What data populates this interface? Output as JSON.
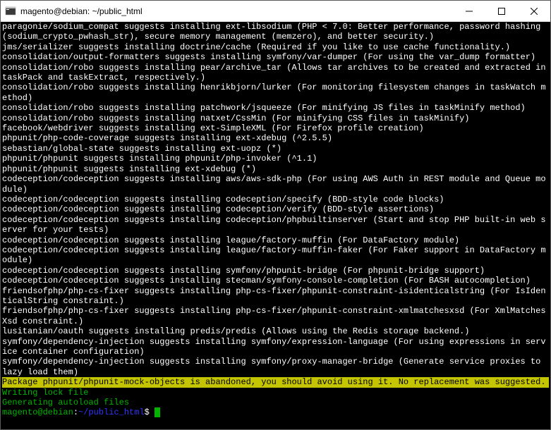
{
  "window": {
    "title": "magento@debian: ~/public_html"
  },
  "terminal": {
    "lines": [
      {
        "text": "paragonie/sodium_compat suggests installing ext-libsodium (PHP < 7.0: Better performance, password hashing (sodium_crypto_pwhash_str), secure memory management (memzero), and better security.)",
        "class": ""
      },
      {
        "text": "jms/serializer suggests installing doctrine/cache (Required if you like to use cache functionality.)",
        "class": ""
      },
      {
        "text": "consolidation/output-formatters suggests installing symfony/var-dumper (For using the var_dump formatter)",
        "class": ""
      },
      {
        "text": "consolidation/robo suggests installing pear/archive_tar (Allows tar archives to be created and extracted in taskPack and taskExtract, respectively.)",
        "class": ""
      },
      {
        "text": "",
        "class": ""
      },
      {
        "text": "consolidation/robo suggests installing henrikbjorn/lurker (For monitoring filesystem changes in taskWatch method)",
        "class": ""
      },
      {
        "text": "consolidation/robo suggests installing patchwork/jsqueeze (For minifying JS files in taskMinify method)",
        "class": ""
      },
      {
        "text": "consolidation/robo suggests installing natxet/CssMin (For minifying CSS files in taskMinify)",
        "class": ""
      },
      {
        "text": "facebook/webdriver suggests installing ext-SimpleXML (For Firefox profile creation)",
        "class": ""
      },
      {
        "text": "phpunit/php-code-coverage suggests installing ext-xdebug (^2.5.5)",
        "class": ""
      },
      {
        "text": "sebastian/global-state suggests installing ext-uopz (*)",
        "class": ""
      },
      {
        "text": "phpunit/phpunit suggests installing phpunit/php-invoker (^1.1)",
        "class": ""
      },
      {
        "text": "phpunit/phpunit suggests installing ext-xdebug (*)",
        "class": ""
      },
      {
        "text": "codeception/codeception suggests installing aws/aws-sdk-php (For using AWS Auth in REST module and Queue module)",
        "class": ""
      },
      {
        "text": "codeception/codeception suggests installing codeception/specify (BDD-style code blocks)",
        "class": ""
      },
      {
        "text": "codeception/codeception suggests installing codeception/verify (BDD-style assertions)",
        "class": ""
      },
      {
        "text": "codeception/codeception suggests installing codeception/phpbuiltinserver (Start and stop PHP built-in web server for your tests)",
        "class": ""
      },
      {
        "text": "codeception/codeception suggests installing league/factory-muffin (For DataFactory module)",
        "class": ""
      },
      {
        "text": "codeception/codeception suggests installing league/factory-muffin-faker (For Faker support in DataFactory module)",
        "class": ""
      },
      {
        "text": "codeception/codeception suggests installing symfony/phpunit-bridge (For phpunit-bridge support)",
        "class": ""
      },
      {
        "text": "codeception/codeception suggests installing stecman/symfony-console-completion (For BASH autocompletion)",
        "class": ""
      },
      {
        "text": "friendsofphp/php-cs-fixer suggests installing php-cs-fixer/phpunit-constraint-isidenticalstring (For IsIdenticalString constraint.)",
        "class": ""
      },
      {
        "text": "friendsofphp/php-cs-fixer suggests installing php-cs-fixer/phpunit-constraint-xmlmatchesxsd (For XmlMatchesXsd constraint.)",
        "class": ""
      },
      {
        "text": "lusitanian/oauth suggests installing predis/predis (Allows using the Redis storage backend.)",
        "class": ""
      },
      {
        "text": "symfony/dependency-injection suggests installing symfony/expression-language (For using expressions in service container configuration)",
        "class": ""
      },
      {
        "text": "symfony/dependency-injection suggests installing symfony/proxy-manager-bridge (Generate service proxies to lazy load them)",
        "class": ""
      },
      {
        "text": "Package phpunit/phpunit-mock-objects is abandoned, you should avoid using it. No replacement was suggested.",
        "class": "yellow-bg"
      },
      {
        "text": "Writing lock file",
        "class": "green"
      },
      {
        "text": "Generating autoload files",
        "class": "green"
      }
    ],
    "prompt": {
      "user": "magento@debian",
      "separator": ":",
      "path": "~/public_html",
      "symbol": "$"
    }
  }
}
